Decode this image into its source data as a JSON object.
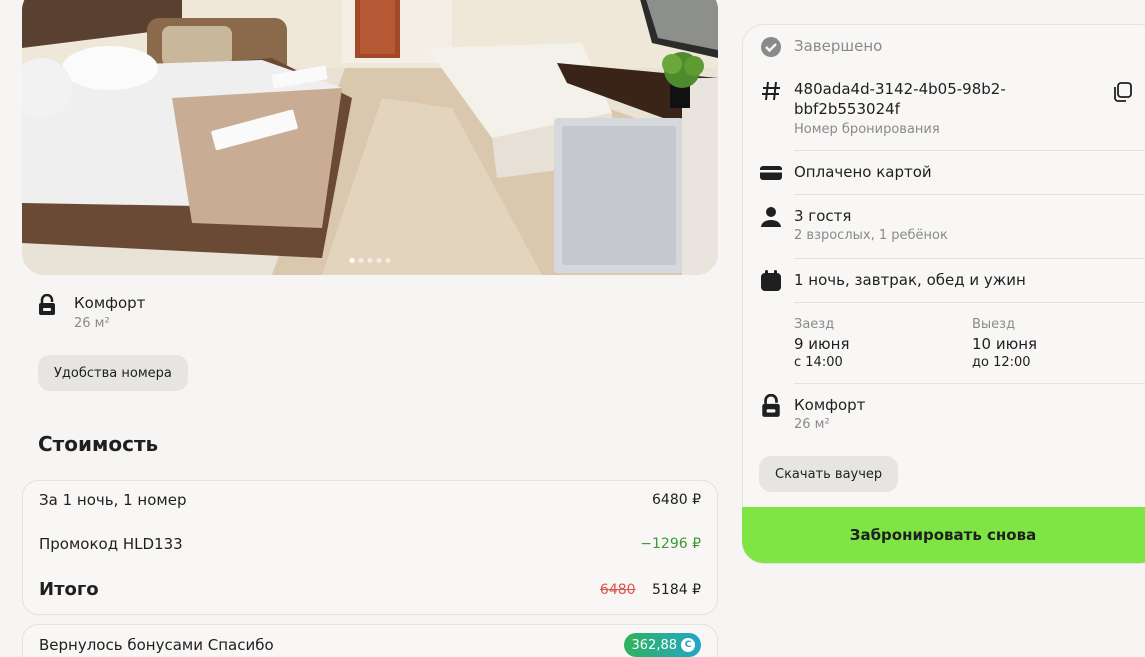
{
  "photo": {
    "slides_count": 5,
    "active_slide": 1
  },
  "room": {
    "name": "Комфорт",
    "area": "26 м²",
    "amenities_button": "Удобства номера"
  },
  "cost": {
    "title": "Стоимость",
    "nightly_label": "За 1 ночь, 1 номер",
    "nightly_value": "6480 ₽",
    "promo_label": "Промокод HLD133",
    "promo_value": "−1296 ₽",
    "total_label": "Итого",
    "total_old": "6480",
    "total_value": "5184 ₽"
  },
  "bonus": {
    "label": "Вернулось бонусами Спасибо",
    "value": "362,88",
    "coin_glyph": "С"
  },
  "booking": {
    "status": "Завершено",
    "id": "480ada4d-3142-4b05-98b2-bbf2b553024f",
    "id_label": "Номер бронирования",
    "payment": "Оплачено картой",
    "guests": "3 гостя",
    "guests_detail": "2 взрослых, 1 ребёнок",
    "meal_plan": "1 ночь, завтрак, обед и ужин",
    "checkin_label": "Заезд",
    "checkin_date": "9 июня",
    "checkin_time": "с 14:00",
    "checkout_label": "Выезд",
    "checkout_date": "10 июня",
    "checkout_time": "до 12:00",
    "room_name": "Комфорт",
    "room_area": "26 м²",
    "voucher_button": "Скачать ваучер",
    "rebook_button": "Забронировать снова"
  },
  "colors": {
    "accent_green": "#7ee545",
    "promo_green": "#3c9a33",
    "strike_red": "#e0544c",
    "muted_text": "#8a8a8a"
  },
  "icons": [
    "lock-icon",
    "check-circle-icon",
    "hash-icon",
    "copy-icon",
    "card-icon",
    "person-icon",
    "calendar-icon"
  ]
}
